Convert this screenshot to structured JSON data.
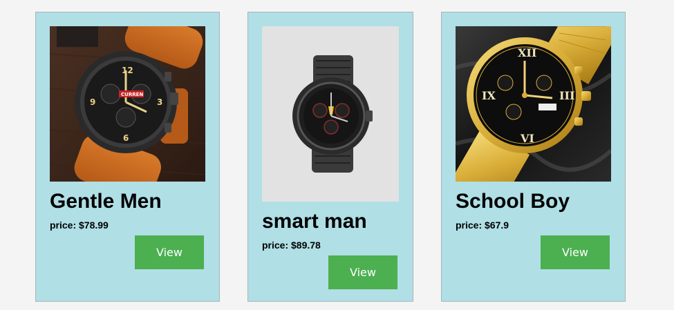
{
  "products": [
    {
      "name": "Gentle Men",
      "price": "price: $78.99",
      "button_label": "View",
      "image_icon": "orange-leather-chronograph-watch-image",
      "image_brand": "CURREN"
    },
    {
      "name": "smart man",
      "price": "price: $89.78",
      "button_label": "View",
      "image_icon": "black-steel-sport-watch-image"
    },
    {
      "name": "School Boy",
      "price": "price: $67.9",
      "button_label": "View",
      "image_icon": "gold-mesh-roman-dial-watch-image"
    }
  ],
  "colors": {
    "card_background": "#b0dfe6",
    "page_background": "#f4f4f4",
    "button_background": "#4caf50",
    "button_text": "#ffffff"
  }
}
